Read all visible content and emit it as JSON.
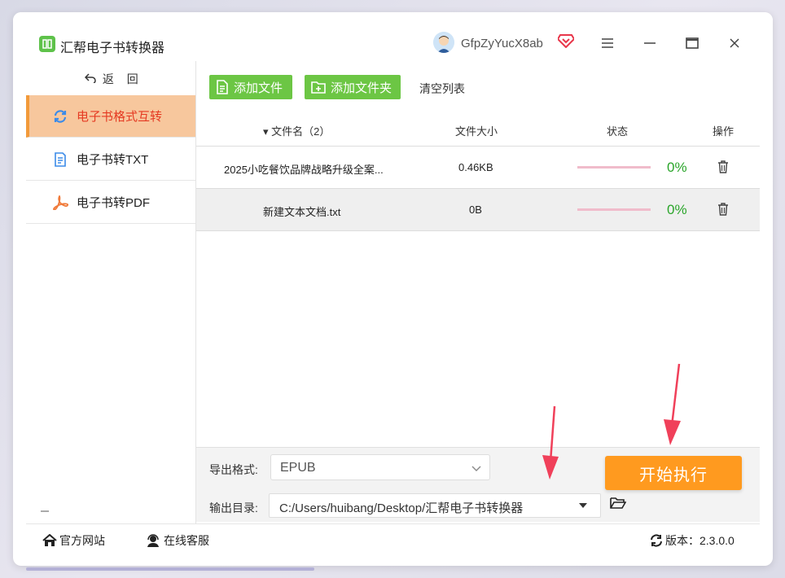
{
  "app": {
    "title": "汇帮电子书转换器",
    "username": "GfpZyYucX8ab"
  },
  "sidebar": {
    "back_label": "返 回",
    "items": [
      {
        "label": "电子书格式互转",
        "active": true,
        "icon": "refresh-icon"
      },
      {
        "label": "电子书转TXT",
        "active": false,
        "icon": "document-icon"
      },
      {
        "label": "电子书转PDF",
        "active": false,
        "icon": "pdf-icon"
      }
    ]
  },
  "toolbar": {
    "add_file": "添加文件",
    "add_folder": "添加文件夹",
    "clear_list": "清空列表"
  },
  "table": {
    "headers": {
      "name": "文件名（2）",
      "size": "文件大小",
      "status": "状态",
      "op": "操作"
    },
    "rows": [
      {
        "name": "2025小吃餐饮品牌战略升级全案...",
        "size": "0.46KB",
        "progress": "0%"
      },
      {
        "name": "新建文本文档.txt",
        "size": "0B",
        "progress": "0%"
      }
    ]
  },
  "output": {
    "format_label": "导出格式:",
    "format_value": "EPUB",
    "dir_label": "输出目录:",
    "dir_value": "C:/Users/huibang/Desktop/汇帮电子书转换器",
    "start_button": "开始执行"
  },
  "footer": {
    "website": "官方网站",
    "service": "在线客服",
    "version": "版本：2.3.0.0"
  },
  "colors": {
    "accent_green": "#6cc644",
    "accent_orange": "#ff9a1f",
    "active_nav_bg": "#f7c79d",
    "active_nav_text": "#e53a22",
    "progress_green": "#2aa52a"
  }
}
